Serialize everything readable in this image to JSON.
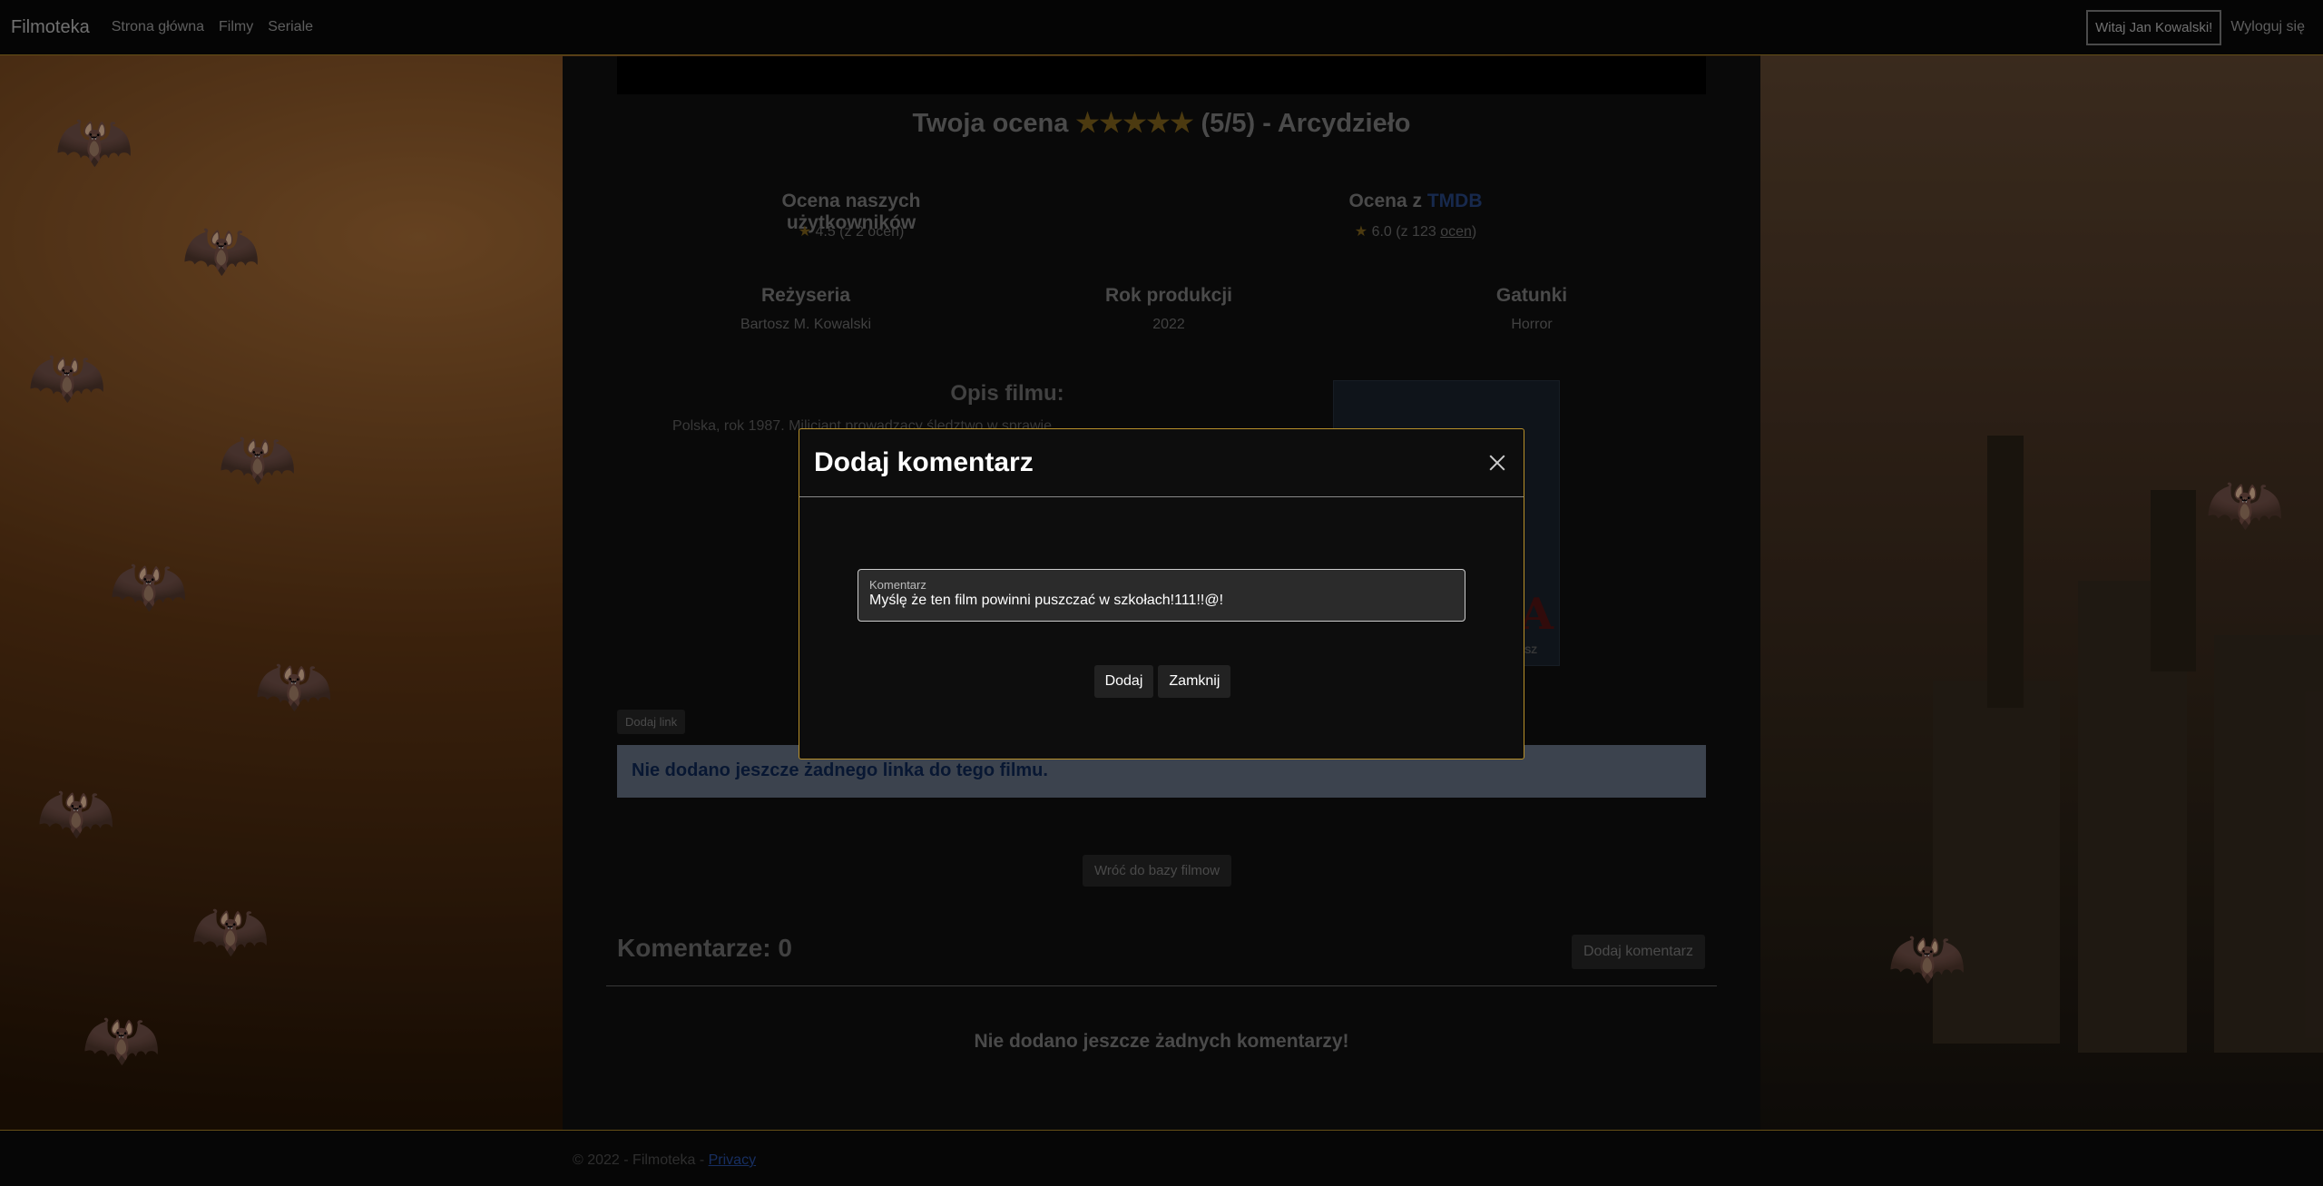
{
  "navbar": {
    "brand": "Filmoteka",
    "links": [
      "Strona główna",
      "Filmy",
      "Seriale"
    ],
    "welcome": "Witaj Jan Kowalski!",
    "logout": "Wyloguj się"
  },
  "movie": {
    "your_rating_label": "Twoja ocena",
    "your_rating_suffix": "(5/5) - Arcydzieło",
    "your_rating_stars": 5,
    "users_rating_title": "Ocena naszych użytkowników",
    "users_rating_value": "4.5 (z 2 ocen)",
    "tmdb_title_prefix": "Ocena z",
    "tmdb_title_link": "TMDB",
    "tmdb_rating_value": "6.0 (z 123",
    "tmdb_rating_link": "ocen",
    "tmdb_rating_close": ")",
    "director_title": "Reżyseria",
    "director": "Bartosz M. Kowalski",
    "year_title": "Rok produkcji",
    "year": "2022",
    "genres_title": "Gatunki",
    "genres": "Horror",
    "description_title": "Opis filmu:",
    "description": "Polska, rok 1987. Milicjant prowadzący śledztwo w sprawie tajemniczych\nprzypadków zaginięcia in",
    "poster_title": "ZA",
    "poster_sub": "SZ"
  },
  "links": {
    "add_link_button": "Dodaj link",
    "empty_alert": "Nie dodano jeszcze żadnego linka do tego filmu."
  },
  "back_button": "Wróć do bazy filmow",
  "comments": {
    "title": "Komentarze: 0",
    "add_button": "Dodaj komentarz",
    "empty": "Nie dodano jeszcze żadnych komentarzy!"
  },
  "footer": {
    "text": "© 2022 - Filmoteka -",
    "privacy": "Privacy"
  },
  "modal": {
    "title": "Dodaj komentarz",
    "field_label": "Komentarz",
    "field_value": "Myślę że ten film powinni puszczać w szkołach!111!!@!",
    "submit": "Dodaj",
    "close": "Zamknij"
  },
  "colors": {
    "accent_gold": "#b8902a",
    "star": "#8a6b1e",
    "alert_bg": "#6e7b8f",
    "tmdb_link": "#2b4c8c"
  }
}
